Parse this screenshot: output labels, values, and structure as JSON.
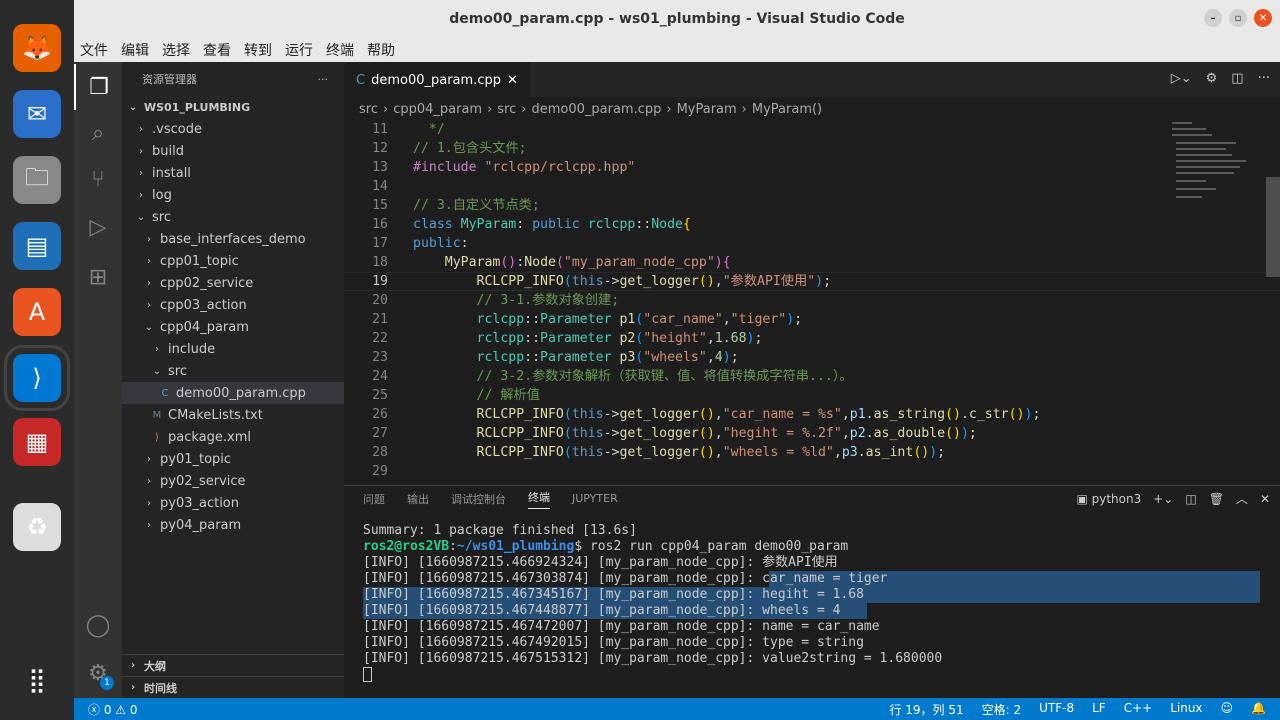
{
  "window": {
    "title": "demo00_param.cpp - ws01_plumbing - Visual Studio Code"
  },
  "menu": [
    "文件",
    "编辑",
    "选择",
    "查看",
    "转到",
    "运行",
    "终端",
    "帮助"
  ],
  "dock": [
    {
      "name": "firefox-icon",
      "glyph": "🦊",
      "bg": "#e66000"
    },
    {
      "name": "thunderbird-icon",
      "glyph": "✉",
      "bg": "#2a6fc9"
    },
    {
      "name": "files-icon",
      "glyph": "🗀",
      "bg": "#888"
    },
    {
      "name": "writer-icon",
      "glyph": "▤",
      "bg": "#1e6fb8"
    },
    {
      "name": "software-icon",
      "glyph": "A",
      "bg": "#e95420"
    },
    {
      "name": "vscode-icon",
      "glyph": "⟩",
      "bg": "#0078d4"
    },
    {
      "name": "terminal-app-icon",
      "glyph": "▦",
      "bg": "#c62828"
    },
    {
      "name": "trash-icon",
      "glyph": "♻",
      "bg": "#ddd"
    }
  ],
  "sidebar": {
    "title": "资源管理器",
    "root": "WS01_PLUMBING",
    "items": [
      {
        "label": ".vscode",
        "depth": 1,
        "type": "folder",
        "open": false
      },
      {
        "label": "build",
        "depth": 1,
        "type": "folder",
        "open": false
      },
      {
        "label": "install",
        "depth": 1,
        "type": "folder",
        "open": false
      },
      {
        "label": "log",
        "depth": 1,
        "type": "folder",
        "open": false
      },
      {
        "label": "src",
        "depth": 1,
        "type": "folder",
        "open": true
      },
      {
        "label": "base_interfaces_demo",
        "depth": 2,
        "type": "folder",
        "open": false
      },
      {
        "label": "cpp01_topic",
        "depth": 2,
        "type": "folder",
        "open": false
      },
      {
        "label": "cpp02_service",
        "depth": 2,
        "type": "folder",
        "open": false
      },
      {
        "label": "cpp03_action",
        "depth": 2,
        "type": "folder",
        "open": false
      },
      {
        "label": "cpp04_param",
        "depth": 2,
        "type": "folder",
        "open": true
      },
      {
        "label": "include",
        "depth": 3,
        "type": "folder",
        "open": false
      },
      {
        "label": "src",
        "depth": 3,
        "type": "folder",
        "open": true
      },
      {
        "label": "demo00_param.cpp",
        "depth": 4,
        "type": "cpp",
        "selected": true
      },
      {
        "label": "CMakeLists.txt",
        "depth": 3,
        "type": "cmake"
      },
      {
        "label": "package.xml",
        "depth": 3,
        "type": "xml"
      },
      {
        "label": "py01_topic",
        "depth": 2,
        "type": "folder",
        "open": false
      },
      {
        "label": "py02_service",
        "depth": 2,
        "type": "folder",
        "open": false
      },
      {
        "label": "py03_action",
        "depth": 2,
        "type": "folder",
        "open": false
      },
      {
        "label": "py04_param",
        "depth": 2,
        "type": "folder",
        "open": false
      }
    ],
    "outline": "大纲",
    "timeline": "时间线"
  },
  "editor": {
    "tab": "demo00_param.cpp",
    "breadcrumbs": [
      "src",
      "cpp04_param",
      "src",
      "demo00_param.cpp",
      "MyParam",
      "MyParam()"
    ],
    "lines": [
      {
        "n": "11",
        "t": [
          [
            "  */",
            "cm"
          ]
        ]
      },
      {
        "n": "12",
        "t": [
          [
            "// 1.包含头文件;",
            "cm"
          ]
        ]
      },
      {
        "n": "13",
        "t": [
          [
            "#include ",
            "pp"
          ],
          [
            "\"rclcpp/rclcpp.hpp\"",
            "st"
          ]
        ]
      },
      {
        "n": "14",
        "t": []
      },
      {
        "n": "15",
        "t": [
          [
            "// 3.自定义节点类;",
            "cm"
          ]
        ]
      },
      {
        "n": "16",
        "t": [
          [
            "class ",
            "kw"
          ],
          [
            "MyParam",
            "ty"
          ],
          [
            ": ",
            "df"
          ],
          [
            "public ",
            "kw"
          ],
          [
            "rclcpp",
            "ty"
          ],
          [
            "::",
            "df"
          ],
          [
            "Node",
            "ty"
          ],
          [
            "{",
            "br"
          ]
        ]
      },
      {
        "n": "17",
        "t": [
          [
            "public",
            "kw"
          ],
          [
            ":",
            "df"
          ]
        ]
      },
      {
        "n": "18",
        "t": [
          [
            "    MyParam",
            "fn"
          ],
          [
            "()",
            "br2"
          ],
          [
            ":",
            "df"
          ],
          [
            "Node",
            "fn"
          ],
          [
            "(",
            "br2"
          ],
          [
            "\"my_param_node_cpp\"",
            "st"
          ],
          [
            ")",
            "br2"
          ],
          [
            "{",
            "br2"
          ]
        ]
      },
      {
        "n": "19",
        "t": [
          [
            "        RCLCPP_INFO",
            "fn"
          ],
          [
            "(",
            "br3"
          ],
          [
            "this",
            "kw"
          ],
          [
            "->",
            "df"
          ],
          [
            "get_logger",
            "fn"
          ],
          [
            "()",
            "br"
          ],
          [
            ",",
            "df"
          ],
          [
            "\"参数API使用\"",
            "st"
          ],
          [
            ")",
            "br3"
          ],
          [
            ";",
            "df"
          ]
        ]
      },
      {
        "n": "20",
        "t": [
          [
            "        // 3-1.参数对象创建;",
            "cm"
          ]
        ]
      },
      {
        "n": "21",
        "t": [
          [
            "        rclcpp",
            "ty"
          ],
          [
            "::",
            "df"
          ],
          [
            "Parameter ",
            "ty"
          ],
          [
            "p1",
            "fn"
          ],
          [
            "(",
            "br3"
          ],
          [
            "\"car_name\"",
            "st"
          ],
          [
            ",",
            "df"
          ],
          [
            "\"tiger\"",
            "st"
          ],
          [
            ")",
            "br3"
          ],
          [
            ";",
            "df"
          ]
        ]
      },
      {
        "n": "22",
        "t": [
          [
            "        rclcpp",
            "ty"
          ],
          [
            "::",
            "df"
          ],
          [
            "Parameter ",
            "ty"
          ],
          [
            "p2",
            "fn"
          ],
          [
            "(",
            "br3"
          ],
          [
            "\"height\"",
            "st"
          ],
          [
            ",",
            "df"
          ],
          [
            "1.68",
            "nm"
          ],
          [
            ")",
            "br3"
          ],
          [
            ";",
            "df"
          ]
        ]
      },
      {
        "n": "23",
        "t": [
          [
            "        rclcpp",
            "ty"
          ],
          [
            "::",
            "df"
          ],
          [
            "Parameter ",
            "ty"
          ],
          [
            "p3",
            "fn"
          ],
          [
            "(",
            "br3"
          ],
          [
            "\"wheels\"",
            "st"
          ],
          [
            ",",
            "df"
          ],
          [
            "4",
            "nm"
          ],
          [
            ")",
            "br3"
          ],
          [
            ";",
            "df"
          ]
        ]
      },
      {
        "n": "24",
        "t": [
          [
            "        // 3-2.参数对象解析（获取键、值、将值转换成字符串...）。",
            "cm"
          ]
        ]
      },
      {
        "n": "25",
        "t": [
          [
            "        // 解析值",
            "cm"
          ]
        ]
      },
      {
        "n": "26",
        "t": [
          [
            "        RCLCPP_INFO",
            "fn"
          ],
          [
            "(",
            "br3"
          ],
          [
            "this",
            "kw"
          ],
          [
            "->",
            "df"
          ],
          [
            "get_logger",
            "fn"
          ],
          [
            "()",
            "br"
          ],
          [
            ",",
            "df"
          ],
          [
            "\"car_name = %s\"",
            "st"
          ],
          [
            ",",
            "df"
          ],
          [
            "p1",
            "va"
          ],
          [
            ".",
            "df"
          ],
          [
            "as_string",
            "fn"
          ],
          [
            "()",
            "br"
          ],
          [
            ".",
            "df"
          ],
          [
            "c_str",
            "fn"
          ],
          [
            "()",
            "br"
          ],
          [
            ")",
            "br3"
          ],
          [
            ";",
            "df"
          ]
        ]
      },
      {
        "n": "27",
        "t": [
          [
            "        RCLCPP_INFO",
            "fn"
          ],
          [
            "(",
            "br3"
          ],
          [
            "this",
            "kw"
          ],
          [
            "->",
            "df"
          ],
          [
            "get_logger",
            "fn"
          ],
          [
            "()",
            "br"
          ],
          [
            ",",
            "df"
          ],
          [
            "\"hegiht = %.2f\"",
            "st"
          ],
          [
            ",",
            "df"
          ],
          [
            "p2",
            "va"
          ],
          [
            ".",
            "df"
          ],
          [
            "as_double",
            "fn"
          ],
          [
            "()",
            "br"
          ],
          [
            ")",
            "br3"
          ],
          [
            ";",
            "df"
          ]
        ]
      },
      {
        "n": "28",
        "t": [
          [
            "        RCLCPP_INFO",
            "fn"
          ],
          [
            "(",
            "br3"
          ],
          [
            "this",
            "kw"
          ],
          [
            "->",
            "df"
          ],
          [
            "get_logger",
            "fn"
          ],
          [
            "()",
            "br"
          ],
          [
            ",",
            "df"
          ],
          [
            "\"wheels = %ld\"",
            "st"
          ],
          [
            ",",
            "df"
          ],
          [
            "p3",
            "va"
          ],
          [
            ".",
            "df"
          ],
          [
            "as_int",
            "fn"
          ],
          [
            "()",
            "br"
          ],
          [
            ")",
            "br3"
          ],
          [
            ";",
            "df"
          ]
        ]
      },
      {
        "n": "29",
        "t": []
      }
    ]
  },
  "panel": {
    "tabs": [
      "问题",
      "输出",
      "调试控制台",
      "终端",
      "JUPYTER"
    ],
    "active": 3,
    "shell": "python3",
    "terminal": [
      {
        "text": "Summary: 1 package finished [13.6s]"
      },
      {
        "prompt_user": "ros2@ros2VB",
        "prompt_path": "~/ws01_plumbing",
        "text": "$ ros2 run cpp04_param demo00_param"
      },
      {
        "text": "[INFO] [1660987215.466924324] [my_param_node_cpp]: 参数API使用"
      },
      {
        "text": "[INFO] [1660987215.467303874] [my_param_node_cpp]: car_name = tiger",
        "hl": "partial"
      },
      {
        "text": "[INFO] [1660987215.467345167] [my_param_node_cpp]: hegiht = 1.68",
        "hl": "full"
      },
      {
        "text": "[INFO] [1660987215.467448877] [my_param_node_cpp]: wheels = 4",
        "hl": "end"
      },
      {
        "text": "[INFO] [1660987215.467472007] [my_param_node_cpp]: name = car_name"
      },
      {
        "text": "[INFO] [1660987215.467492015] [my_param_node_cpp]: type = string"
      },
      {
        "text": "[INFO] [1660987215.467515312] [my_param_node_cpp]: value2string = 1.680000"
      }
    ]
  },
  "status": {
    "errors": "0",
    "warnings": "0",
    "position": "行 19，列 51",
    "spaces": "空格: 2",
    "encoding": "UTF-8",
    "eol": "LF",
    "language": "C++",
    "os": "Linux"
  },
  "badge": "1"
}
